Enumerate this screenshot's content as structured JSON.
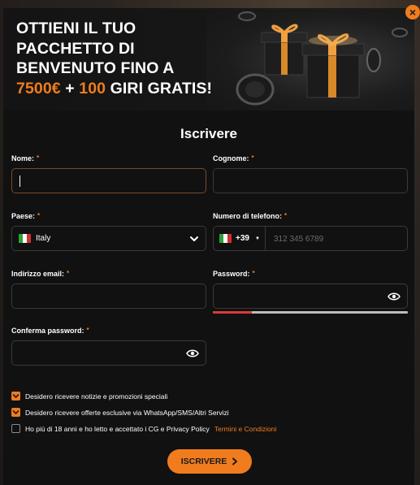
{
  "banner": {
    "line1": "OTTIENI IL TUO",
    "line2": "PACCHETTO DI",
    "line3": "BENVENUTO FINO A",
    "amount": "7500€",
    "plus": " + ",
    "spins": "100",
    "spins_text": " GIRI GRATIS!"
  },
  "close_glyph": "×",
  "form": {
    "title": "Iscrivere",
    "required_mark": "*",
    "first_name": {
      "label": "Nome:",
      "value": ""
    },
    "last_name": {
      "label": "Cognome:",
      "value": ""
    },
    "country": {
      "label": "Paese:",
      "value": "Italy"
    },
    "phone": {
      "label": "Numero di telefono:",
      "prefix": "+39",
      "placeholder": "312 345 6789",
      "value": ""
    },
    "email": {
      "label": "Indirizzo email:",
      "value": ""
    },
    "password": {
      "label": "Password:",
      "value": "",
      "strength": 0.2
    },
    "confirm_password": {
      "label": "Conferma password:",
      "value": ""
    }
  },
  "consents": [
    {
      "text": "Desidero ricevere notizie e promozioni speciali",
      "checked": true
    },
    {
      "text": "Desidero ricevere offerte esclusive via WhatsApp/SMS/Altri Servizi",
      "checked": true
    },
    {
      "text": "Ho più di 18 anni e ho letto e accettato i CG e Privacy Policy",
      "link": "Termini e Condizioni",
      "checked": false
    }
  ],
  "submit_label": "ISCRIVERE",
  "colors": {
    "accent": "#f07c1e",
    "background": "#111111",
    "strength_weak": "#d83a3a"
  },
  "icons": [
    "close-icon",
    "chevron-down-icon",
    "eye-icon",
    "check-icon",
    "chevron-right-icon",
    "italy-flag-icon",
    "gift-box-icon",
    "poker-chip-icon"
  ]
}
